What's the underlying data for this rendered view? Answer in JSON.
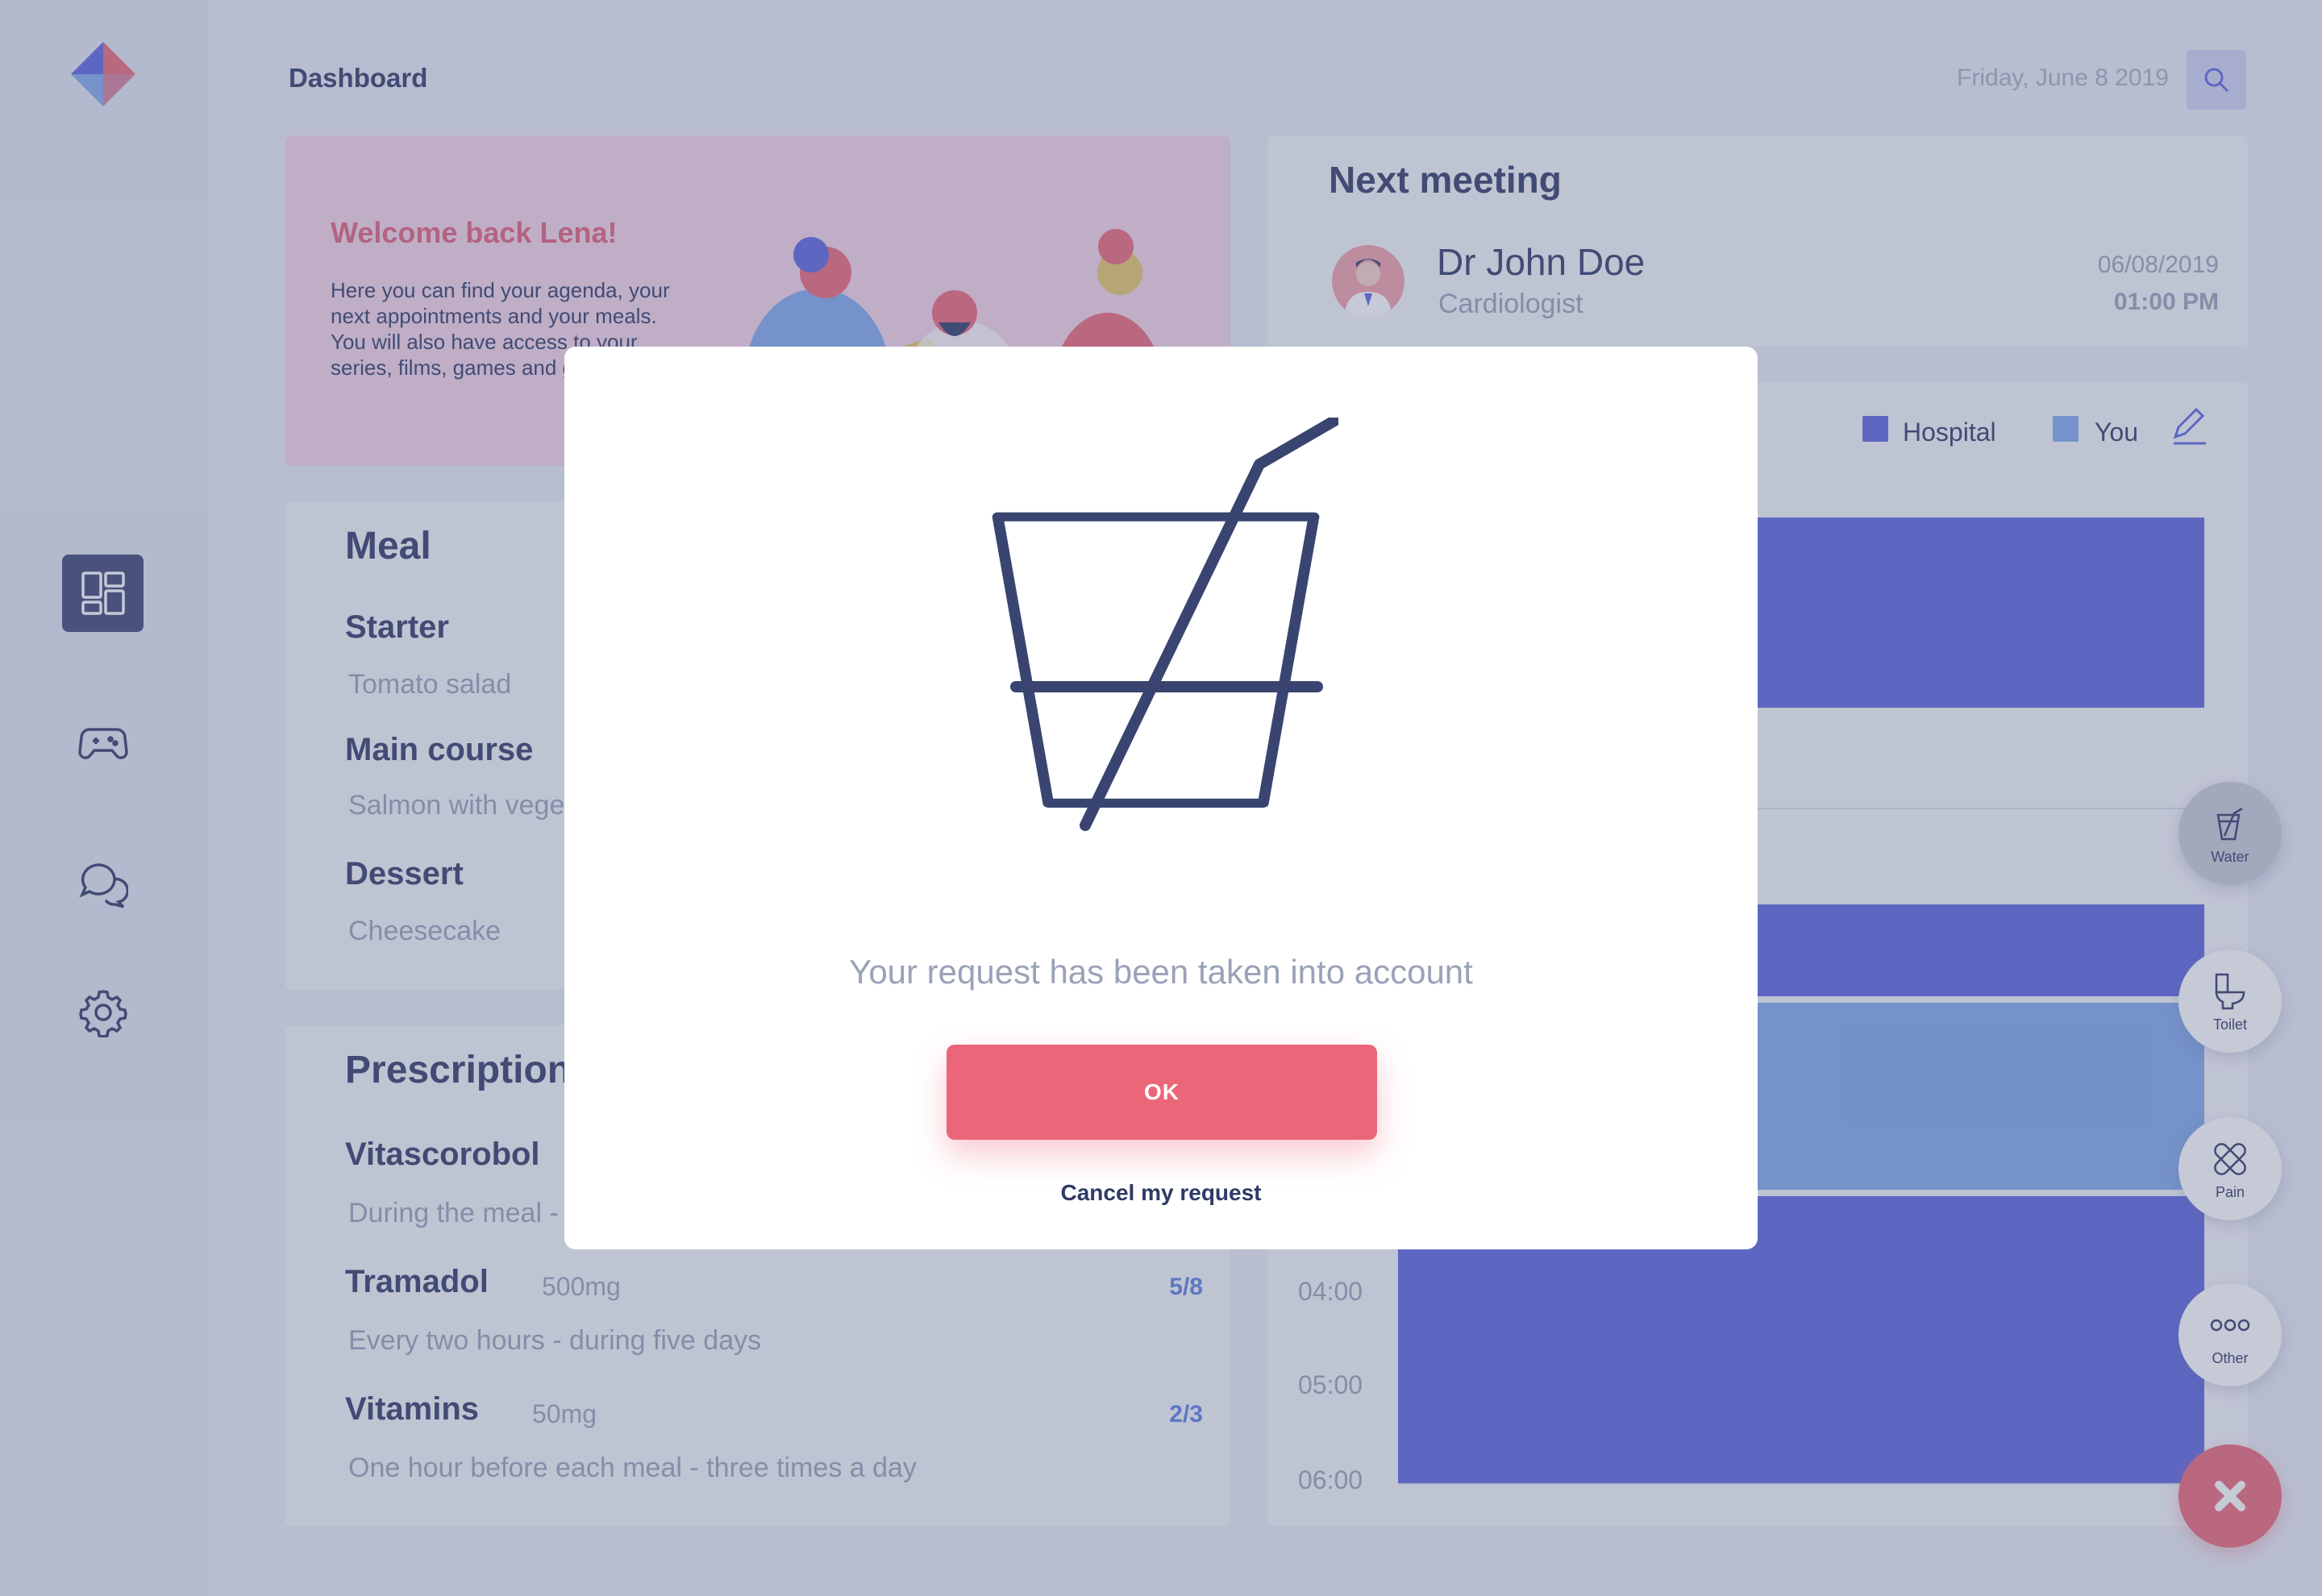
{
  "header": {
    "title": "Dashboard",
    "date": "Friday, June 8 2019"
  },
  "welcome": {
    "title": "Welcome back Lena!",
    "text": "Here you can find your agenda, your next appointments and your meals. You will also have access to your series, films, games and group chat."
  },
  "meeting": {
    "heading": "Next meeting",
    "doctor": "Dr John Doe",
    "role": "Cardiologist",
    "date": "06/08/2019",
    "time": "01:00 PM"
  },
  "meal": {
    "heading": "Meal",
    "items": [
      {
        "course": "Starter",
        "dish": "Tomato salad"
      },
      {
        "course": "Main course",
        "dish": "Salmon with vegetables"
      },
      {
        "course": "Dessert",
        "dish": "Cheesecake"
      }
    ]
  },
  "prescription": {
    "heading": "Prescription",
    "items": [
      {
        "name": "Vitascorobol",
        "dose": "",
        "note": "During the meal - three times a day",
        "count": ""
      },
      {
        "name": "Tramadol",
        "dose": "500mg",
        "note": "Every two hours - during five days",
        "count": "5/8"
      },
      {
        "name": "Vitamins",
        "dose": "50mg",
        "note": "One hour before each meal - three times a day",
        "count": "2/3"
      }
    ]
  },
  "chart": {
    "legend": [
      {
        "label": "Hospital",
        "color": "#5b66e0"
      },
      {
        "label": "You",
        "color": "#80a9ec"
      }
    ],
    "ticks": [
      "04:00",
      "05:00",
      "06:00"
    ]
  },
  "quick_actions": [
    {
      "label": "Water",
      "icon": "water-glass-icon",
      "selected": true
    },
    {
      "label": "Toilet",
      "icon": "toilet-icon",
      "selected": false
    },
    {
      "label": "Pain",
      "icon": "bandage-icon",
      "selected": false
    },
    {
      "label": "Other",
      "icon": "more-dots-icon",
      "selected": false
    }
  ],
  "modal": {
    "icon": "water-glass-icon",
    "message": "Your request has been taken into account",
    "ok_label": "OK",
    "cancel_label": "Cancel my request"
  },
  "colors": {
    "accent": "#ec6679",
    "navy": "#2f3a66",
    "hospital": "#5b66e0",
    "you": "#80a9ec"
  }
}
